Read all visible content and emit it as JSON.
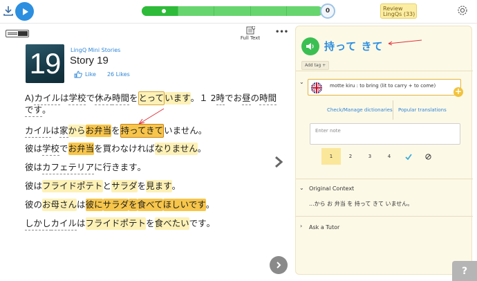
{
  "topbar": {
    "counter": "0",
    "review_line1": "Review",
    "review_line2": "LingQs (33)"
  },
  "reader": {
    "view_mode_label": "Full Text",
    "lesson_number": "19",
    "course": "LingQ Mini Stories",
    "title": "Story 19",
    "like_label": "Like",
    "likes_count": "26 Likes",
    "lines": [
      [
        "A)",
        "カイル",
        "は",
        "学校",
        "で",
        "休み",
        "時間",
        "を",
        "とって",
        "います",
        "。",
        "１ 2",
        "時",
        "でお",
        "昼",
        "の",
        "時間"
      ],
      [
        "です",
        "。"
      ],
      [
        "カイル",
        "は",
        "家",
        "から",
        "お弁当",
        "を",
        "持ってきて",
        "いません",
        "。"
      ],
      [
        "彼",
        "は",
        "学校",
        "で",
        "お弁当",
        "を",
        "買わなければ",
        "なりません",
        "。"
      ],
      [
        "彼",
        "は",
        "カフェテリア",
        "に",
        "行きます",
        "。"
      ],
      [
        "彼",
        "は",
        "フライドポテト",
        "と",
        "サラダ",
        "を",
        "見ます",
        "。"
      ],
      [
        "彼",
        "の",
        "お母さん",
        "は",
        "彼に",
        "サラダ",
        "を",
        "食べて",
        "ほしいです",
        "。"
      ],
      [
        "しかし",
        "カイル",
        "は",
        "フライドポテト",
        "を",
        "食べたい",
        "です",
        "。"
      ]
    ]
  },
  "panel": {
    "term": "持って きて",
    "add_tag": "Add tag +",
    "meaning": "motte kiru :  to bring  (lit to carry + to come)",
    "check_dicts": "Check/Manage dictionaries",
    "popular": "Popular translations",
    "note_placeholder": "Enter note",
    "statuses": [
      "1",
      "2",
      "3",
      "4"
    ],
    "original_context_label": "Original Context",
    "context_text": "...から お 弁当 を 持って きて いません。",
    "ask_tutor": "Ask a Tutor"
  },
  "help_label": "?",
  "colors": {
    "accent_blue": "#2d8fe0",
    "progress_green": "#67d56e",
    "known_yellow": "#fdf1b6",
    "lingq_orange": "#f7c54a",
    "panel_bg": "#fdf9e7",
    "annotation_red": "#e0303a"
  }
}
